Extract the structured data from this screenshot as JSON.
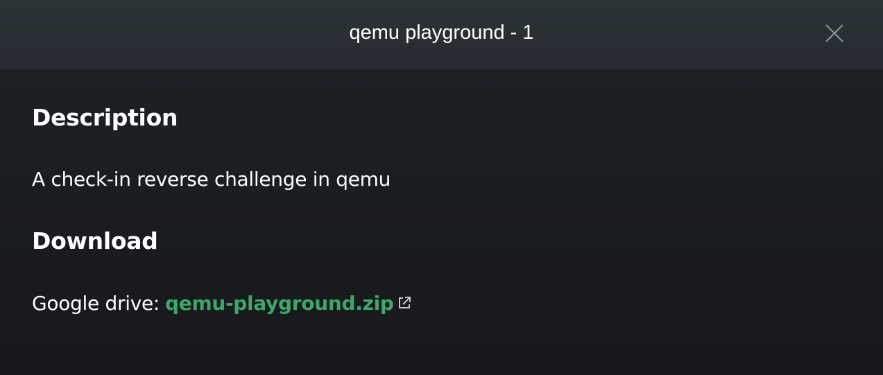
{
  "modal": {
    "title": "qemu playground - 1",
    "close_icon": "close-icon"
  },
  "description": {
    "heading": "Description",
    "text": "A check-in reverse challenge in qemu"
  },
  "download": {
    "heading": "Download",
    "label": "Google drive:",
    "link_text": "qemu-playground.zip",
    "link_icon": "external-link-icon",
    "link_color": "#3fa66a"
  }
}
